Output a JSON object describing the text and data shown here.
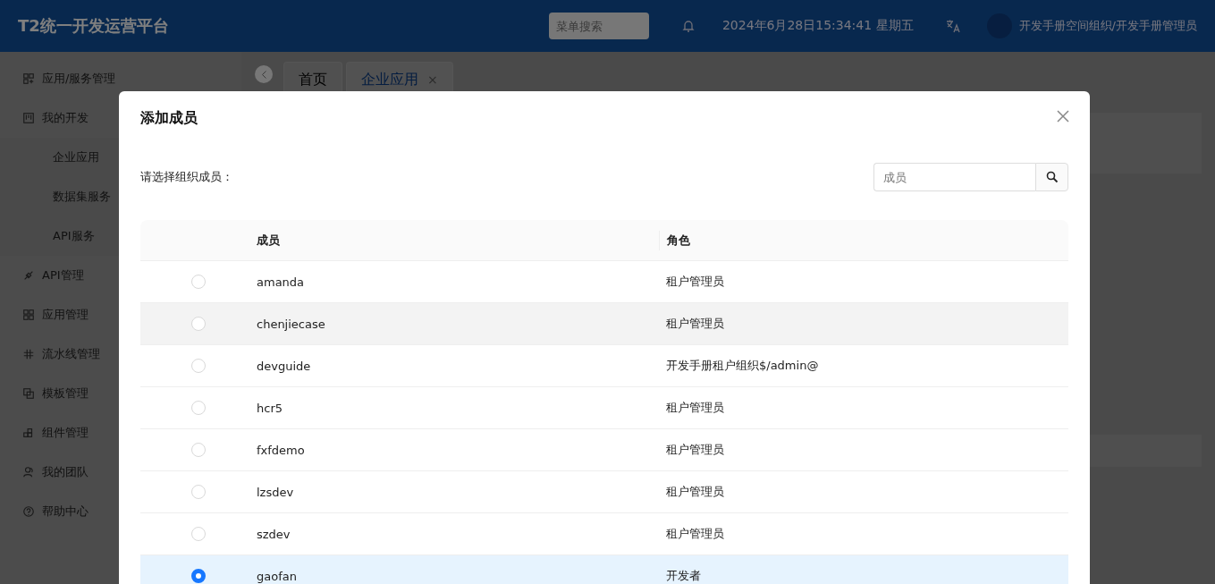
{
  "header": {
    "title": "T2统一开发运营平台",
    "menu_search": {
      "placeholder": "菜单搜索"
    },
    "datetime": "2024年6月28日15:34:41 星期五",
    "user": "开发手册空间组织/开发手册管理员"
  },
  "sidebar": {
    "items": [
      {
        "label": "应用/服务管理"
      },
      {
        "label": "我的开发",
        "expanded": true,
        "children": [
          {
            "label": "企业应用"
          },
          {
            "label": "数据集服务"
          },
          {
            "label": "API服务"
          }
        ]
      },
      {
        "label": "API管理"
      },
      {
        "label": "应用管理"
      },
      {
        "label": "流水线管理"
      },
      {
        "label": "模板管理"
      },
      {
        "label": "组件管理"
      },
      {
        "label": "我的团队"
      },
      {
        "label": "帮助中心"
      }
    ]
  },
  "tabs": [
    {
      "label": "首页",
      "selected": false
    },
    {
      "label": "企业应用",
      "selected": true,
      "close": "×"
    }
  ],
  "dialog": {
    "title": "添加成员",
    "prompt": "请选择组织成员：",
    "search": {
      "placeholder": "成员"
    },
    "table": {
      "columns": [
        "成员",
        "角色"
      ],
      "rows": [
        {
          "member": "amanda",
          "role": "租户管理员",
          "selected": false,
          "hovered": false
        },
        {
          "member": "chenjiecase",
          "role": "租户管理员",
          "selected": false,
          "hovered": true
        },
        {
          "member": "devguide",
          "role": "开发手册租户组织$/admin@",
          "selected": false,
          "hovered": false
        },
        {
          "member": "hcr5",
          "role": "租户管理员",
          "selected": false,
          "hovered": false
        },
        {
          "member": "fxfdemo",
          "role": "租户管理员",
          "selected": false,
          "hovered": false
        },
        {
          "member": "lzsdev",
          "role": "租户管理员",
          "selected": false,
          "hovered": false
        },
        {
          "member": "szdev",
          "role": "租户管理员",
          "selected": false,
          "hovered": false
        },
        {
          "member": "gaofan",
          "role": "开发者",
          "selected": true,
          "hovered": false
        }
      ]
    }
  }
}
